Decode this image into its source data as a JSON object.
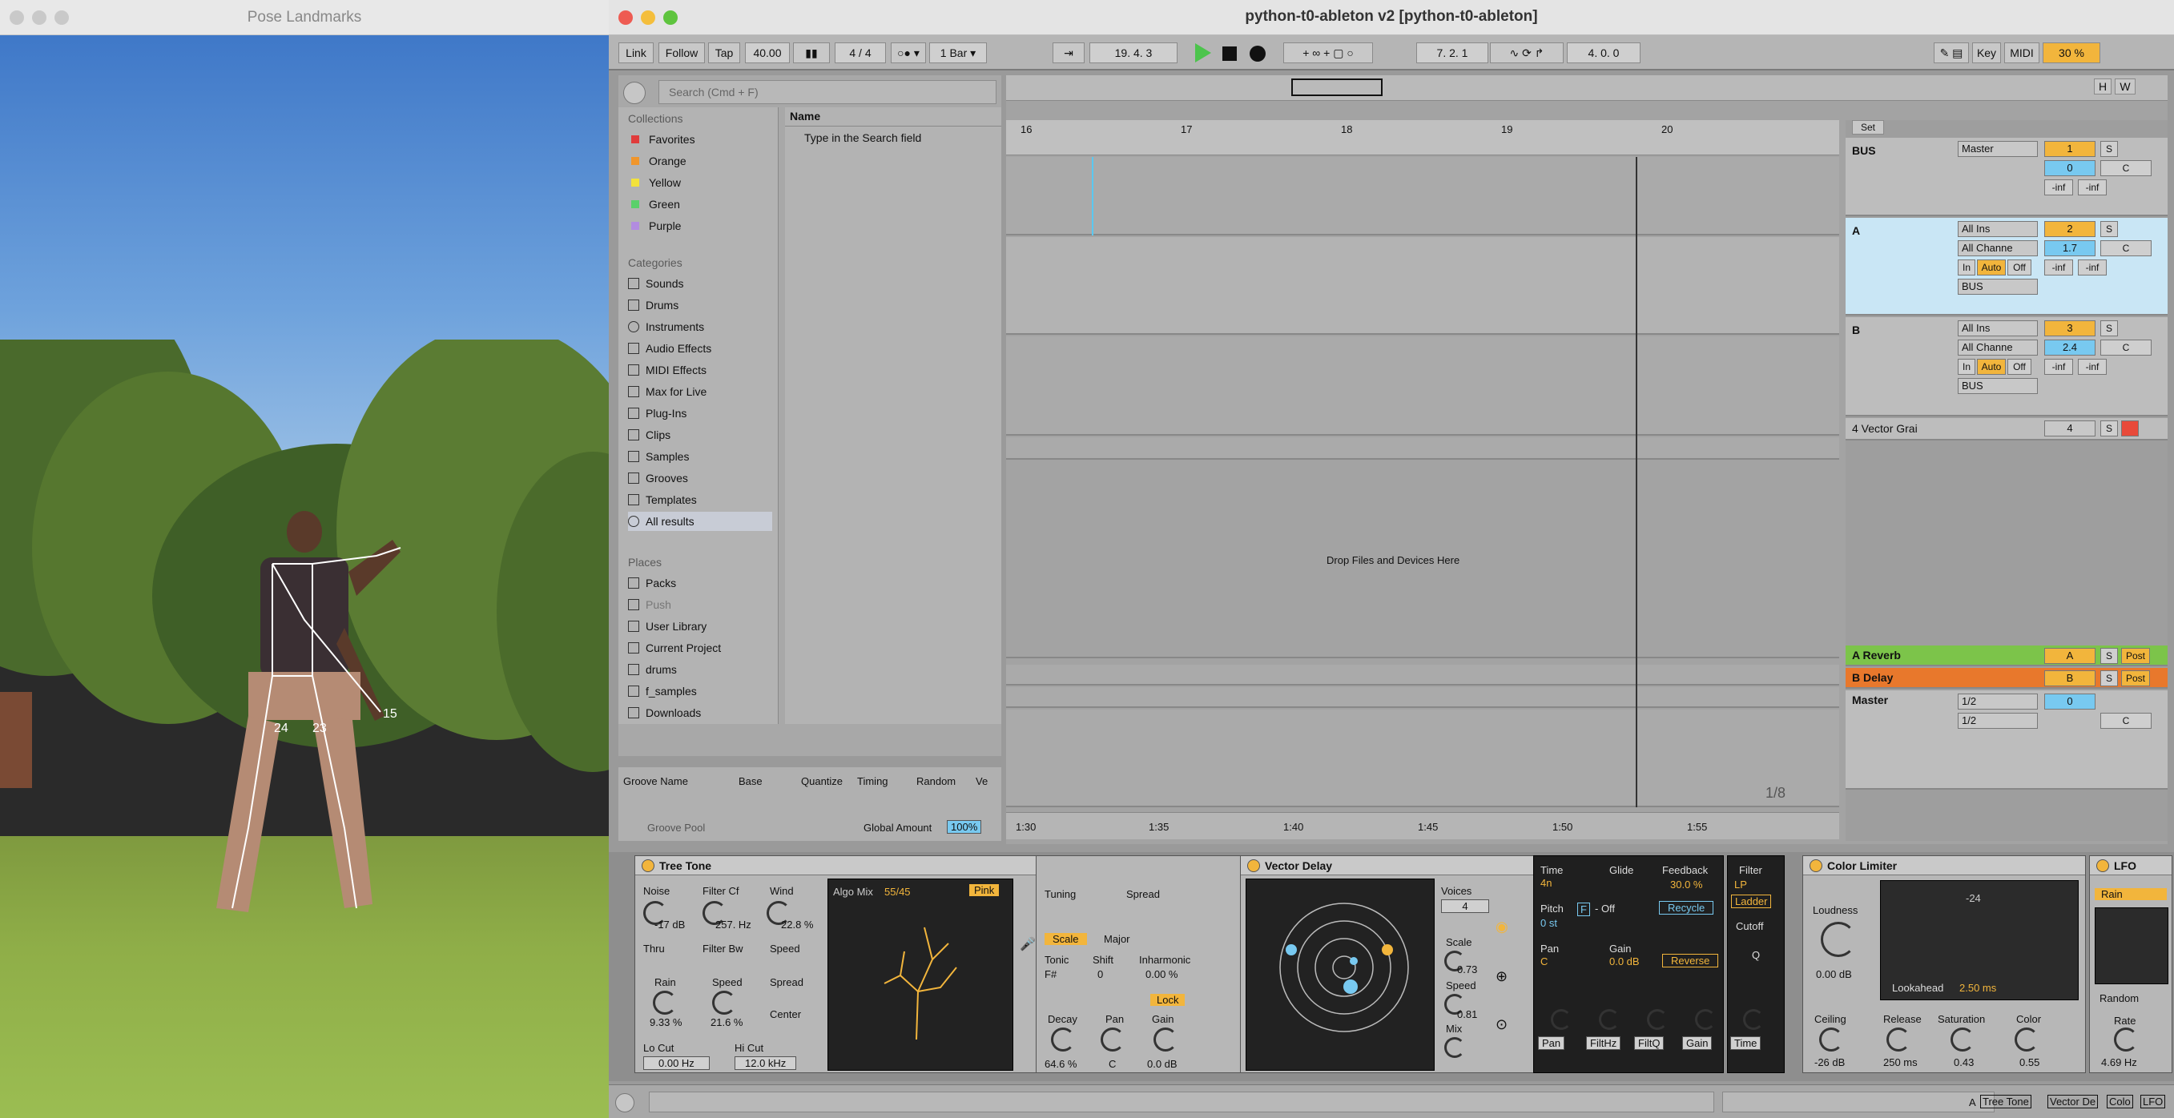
{
  "pose_window": {
    "title": "Pose Landmarks",
    "landmark_labels": [
      "24",
      "23",
      "15"
    ]
  },
  "live_window": {
    "title": "python-t0-ableton v2  [python-t0-ableton]"
  },
  "transport": {
    "link": "Link",
    "follow": "Follow",
    "tap": "Tap",
    "tempo": "40.00",
    "signature": "4 / 4",
    "quantize": "1 Bar",
    "position": "19.   4.   3",
    "loop_start": "7.   2.   1",
    "loop_length": "4.   0.   0",
    "key": "Key",
    "midi": "MIDI",
    "cpu": "30 %"
  },
  "browser": {
    "search_placeholder": "Search (Cmd + F)",
    "collections_header": "Collections",
    "collections": [
      {
        "label": "Favorites",
        "color": "#e03c3c"
      },
      {
        "label": "Orange",
        "color": "#f0962c"
      },
      {
        "label": "Yellow",
        "color": "#f2e23c"
      },
      {
        "label": "Green",
        "color": "#5ad06a"
      },
      {
        "label": "Purple",
        "color": "#b28ce0"
      }
    ],
    "categories_header": "Categories",
    "categories": [
      "Sounds",
      "Drums",
      "Instruments",
      "Audio Effects",
      "MIDI Effects",
      "Max for Live",
      "Plug-Ins",
      "Clips",
      "Samples",
      "Grooves",
      "Templates",
      "All results"
    ],
    "places_header": "Places",
    "places": [
      "Packs",
      "Push",
      "User Library",
      "Current Project",
      "drums",
      "f_samples",
      "Downloads"
    ],
    "name_header": "Name",
    "hint": "Type in the Search field"
  },
  "groove": {
    "cols": [
      "Groove Name",
      "Base",
      "Quantize",
      "Timing",
      "Random",
      "Ve"
    ],
    "pool": "Groove Pool",
    "global_amount_label": "Global Amount",
    "global_amount": "100%"
  },
  "arrangement": {
    "bars": [
      "16",
      "17",
      "18",
      "19",
      "20"
    ],
    "times": [
      "1:30",
      "1:35",
      "1:40",
      "1:45",
      "1:50",
      "1:55"
    ],
    "drop_hint": "Drop Files and Devices Here",
    "zoom": "1/8",
    "set_label": "Set",
    "h": "H",
    "w": "W"
  },
  "tracks": [
    {
      "name": "BUS",
      "io": "Master",
      "num": "1",
      "vol": "0",
      "pan": "C",
      "l": "-inf",
      "r": "-inf"
    },
    {
      "name": "A",
      "io": "All Ins",
      "ch": "All Channe",
      "num": "2",
      "vol": "1.7",
      "pan": "C",
      "l": "-inf",
      "r": "-inf",
      "out": "BUS"
    },
    {
      "name": "B",
      "io": "All Ins",
      "ch": "All Channe",
      "num": "3",
      "vol": "2.4",
      "pan": "C",
      "l": "-inf",
      "r": "-inf",
      "out": "BUS"
    },
    {
      "name": "4 Vector Grai",
      "num": "4"
    }
  ],
  "returns": [
    {
      "name": "A Reverb",
      "letter": "A",
      "post": "Post",
      "color": "#7cc44a"
    },
    {
      "name": "B Delay",
      "letter": "B",
      "post": "Post",
      "color": "#e8782c"
    },
    {
      "name": "Master",
      "io1": "1/2",
      "io2": "1/2",
      "vol": "0",
      "pan": "C"
    }
  ],
  "mon": {
    "in": "In",
    "auto": "Auto",
    "off": "Off",
    "s": "S"
  },
  "tree_tone": {
    "title": "Tree Tone",
    "noise": "Noise",
    "noise_val": "-17 dB",
    "filter_cf": "Filter Cf",
    "filter_cf_val": "257. Hz",
    "wind": "Wind",
    "wind_val": "22.8 %",
    "thru": "Thru",
    "filter_bw": "Filter Bw",
    "speed": "Speed",
    "rain": "Rain",
    "rain_val": "9.33 %",
    "speed2": "Speed",
    "speed2_val": "21.6 %",
    "spread": "Spread",
    "center": "Center",
    "lo_cut": "Lo Cut",
    "lo_cut_val": "0.00 Hz",
    "hi_cut": "Hi Cut",
    "hi_cut_val": "12.0 kHz",
    "algo_mix": "Algo Mix",
    "algo_mix_val": "55/45",
    "pink": "Pink",
    "tuning": "Tuning",
    "spread2": "Spread",
    "scale": "Scale",
    "scale_val": "Major",
    "tonic": "Tonic",
    "tonic_val": "F#",
    "shift": "Shift",
    "shift_val": "0",
    "inharmonic": "Inharmonic",
    "inharmonic_val": "0.00 %",
    "lock": "Lock",
    "decay": "Decay",
    "decay_val": "64.6 %",
    "pan": "Pan",
    "pan_val": "C",
    "gain": "Gain",
    "gain_val": "0.0 dB"
  },
  "vector_delay": {
    "title": "Vector Delay",
    "voices": "Voices",
    "voices_val": "4",
    "scale": "Scale",
    "scale_val": "0.73",
    "speed": "Speed",
    "speed_val": "0.81",
    "mix": "Mix",
    "time": "Time",
    "time_val": "4n",
    "glide": "Glide",
    "feedback": "Feedback",
    "feedback_val": "30.0 %",
    "pitch": "Pitch",
    "pitch_mode": "F",
    "pitch_off": "- Off",
    "pitch_val": "0 st",
    "recycle": "Recycle",
    "pan": "Pan",
    "pan_val": "C",
    "gain": "Gain",
    "gain_val": "0.0 dB",
    "reverse": "Reverse",
    "filter": "Filter",
    "filter_val": "LP",
    "ladder": "Ladder",
    "cutoff": "Cutoff",
    "q": "Q",
    "mods": [
      "Pan",
      "FiltHz",
      "FiltQ",
      "Gain",
      "Time"
    ]
  },
  "color_limiter": {
    "title": "Color Limiter",
    "loudness": "Loudness",
    "loudness_val": "0.00 dB",
    "meter": "-24",
    "lookahead": "Lookahead",
    "lookahead_val": "2.50 ms",
    "ceiling": "Ceiling",
    "ceiling_val": "-26 dB",
    "release": "Release",
    "release_val": "250 ms",
    "saturation": "Saturation",
    "saturation_val": "0.43",
    "color": "Color",
    "color_val": "0.55"
  },
  "lfo": {
    "title": "LFO",
    "rain": "Rain",
    "random": "Random",
    "rate": "Rate",
    "rate_val": "4.69 Hz"
  },
  "status": {
    "track": "A",
    "chain": [
      "Tree Tone",
      "Vector De",
      "Colo",
      "LFO"
    ]
  }
}
